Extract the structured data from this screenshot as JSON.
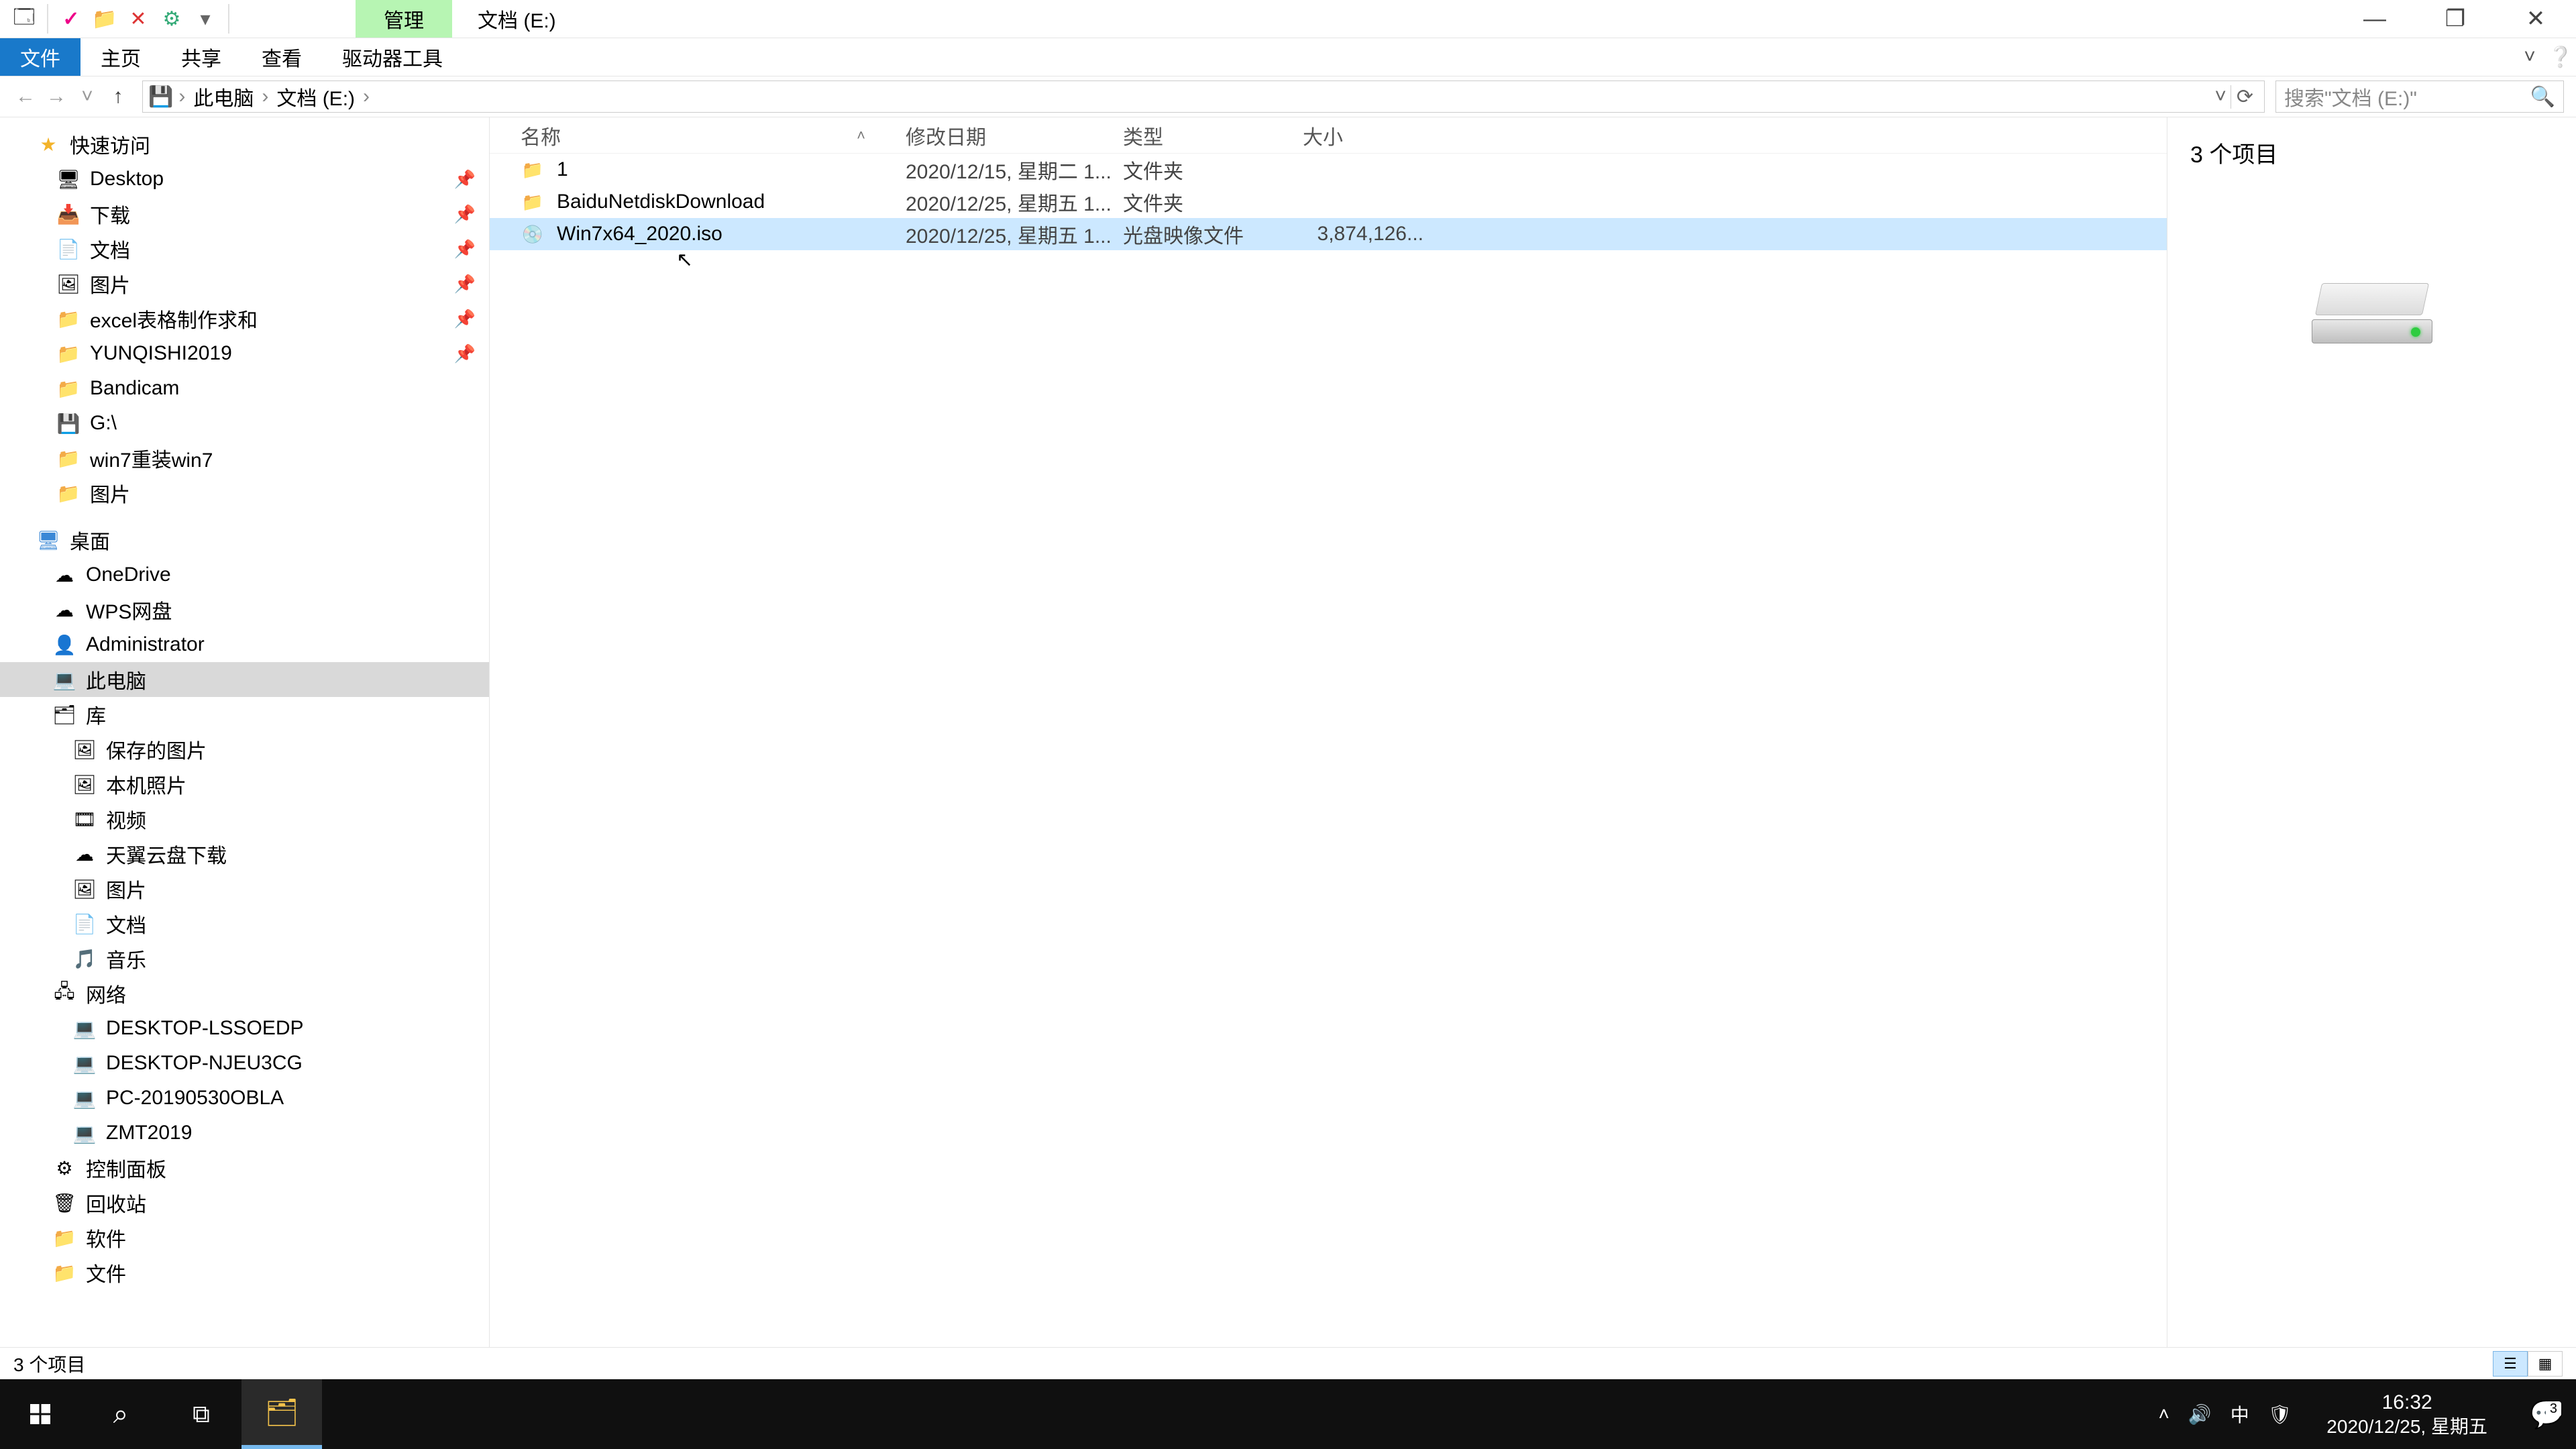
{
  "titlebar": {
    "contextual_tab": "管理",
    "title": "文档 (E:)"
  },
  "ribbon": {
    "file": "文件",
    "home": "主页",
    "share": "共享",
    "view": "查看",
    "drive_tools": "驱动器工具"
  },
  "nav": {
    "breadcrumb": [
      "此电脑",
      "文档 (E:)"
    ],
    "search_placeholder": "搜索\"文档 (E:)\""
  },
  "tree": {
    "quick_access": "快速访问",
    "quick_items": [
      {
        "label": "Desktop",
        "icon": "🖥",
        "pinned": true
      },
      {
        "label": "下载",
        "icon": "📥",
        "pinned": true
      },
      {
        "label": "文档",
        "icon": "📄",
        "pinned": true
      },
      {
        "label": "图片",
        "icon": "🖼",
        "pinned": true
      },
      {
        "label": "excel表格制作求和",
        "icon": "📁",
        "pinned": true
      },
      {
        "label": "YUNQISHI2019",
        "icon": "📁",
        "pinned": true
      },
      {
        "label": "Bandicam",
        "icon": "📁",
        "pinned": false
      },
      {
        "label": "G:\\",
        "icon": "💾",
        "pinned": false
      },
      {
        "label": "win7重装win7",
        "icon": "📁",
        "pinned": false
      },
      {
        "label": "图片",
        "icon": "📁",
        "pinned": false
      }
    ],
    "desktop": "桌面",
    "desktop_items": [
      {
        "label": "OneDrive",
        "icon": "☁"
      },
      {
        "label": "WPS网盘",
        "icon": "☁"
      },
      {
        "label": "Administrator",
        "icon": "👤"
      },
      {
        "label": "此电脑",
        "icon": "💻",
        "selected": true
      },
      {
        "label": "库",
        "icon": "🗂"
      },
      {
        "label": "保存的图片",
        "icon": "🖼",
        "indent": 1
      },
      {
        "label": "本机照片",
        "icon": "🖼",
        "indent": 1
      },
      {
        "label": "视频",
        "icon": "🎞",
        "indent": 1
      },
      {
        "label": "天翼云盘下载",
        "icon": "☁",
        "indent": 1
      },
      {
        "label": "图片",
        "icon": "🖼",
        "indent": 1
      },
      {
        "label": "文档",
        "icon": "📄",
        "indent": 1
      },
      {
        "label": "音乐",
        "icon": "🎵",
        "indent": 1
      },
      {
        "label": "网络",
        "icon": "🖧"
      },
      {
        "label": "DESKTOP-LSSOEDP",
        "icon": "💻",
        "indent": 1
      },
      {
        "label": "DESKTOP-NJEU3CG",
        "icon": "💻",
        "indent": 1
      },
      {
        "label": "PC-20190530OBLA",
        "icon": "💻",
        "indent": 1
      },
      {
        "label": "ZMT2019",
        "icon": "💻",
        "indent": 1
      },
      {
        "label": "控制面板",
        "icon": "⚙"
      },
      {
        "label": "回收站",
        "icon": "🗑"
      },
      {
        "label": "软件",
        "icon": "📁"
      },
      {
        "label": "文件",
        "icon": "📁"
      }
    ]
  },
  "columns": {
    "name": "名称",
    "date": "修改日期",
    "type": "类型",
    "size": "大小"
  },
  "rows": [
    {
      "icon": "📁",
      "name": "1",
      "date": "2020/12/15, 星期二 1...",
      "type": "文件夹",
      "size": "",
      "selected": false,
      "kind": "folder"
    },
    {
      "icon": "📁",
      "name": "BaiduNetdiskDownload",
      "date": "2020/12/25, 星期五 1...",
      "type": "文件夹",
      "size": "",
      "selected": false,
      "kind": "folder"
    },
    {
      "icon": "💿",
      "name": "Win7x64_2020.iso",
      "date": "2020/12/25, 星期五 1...",
      "type": "光盘映像文件",
      "size": "3,874,126...",
      "selected": true,
      "kind": "iso"
    }
  ],
  "preview": {
    "summary": "3 个项目"
  },
  "statusbar": {
    "text": "3 个项目"
  },
  "taskbar": {
    "time": "16:32",
    "date": "2020/12/25, 星期五",
    "ime": "中",
    "notif_count": "3"
  }
}
